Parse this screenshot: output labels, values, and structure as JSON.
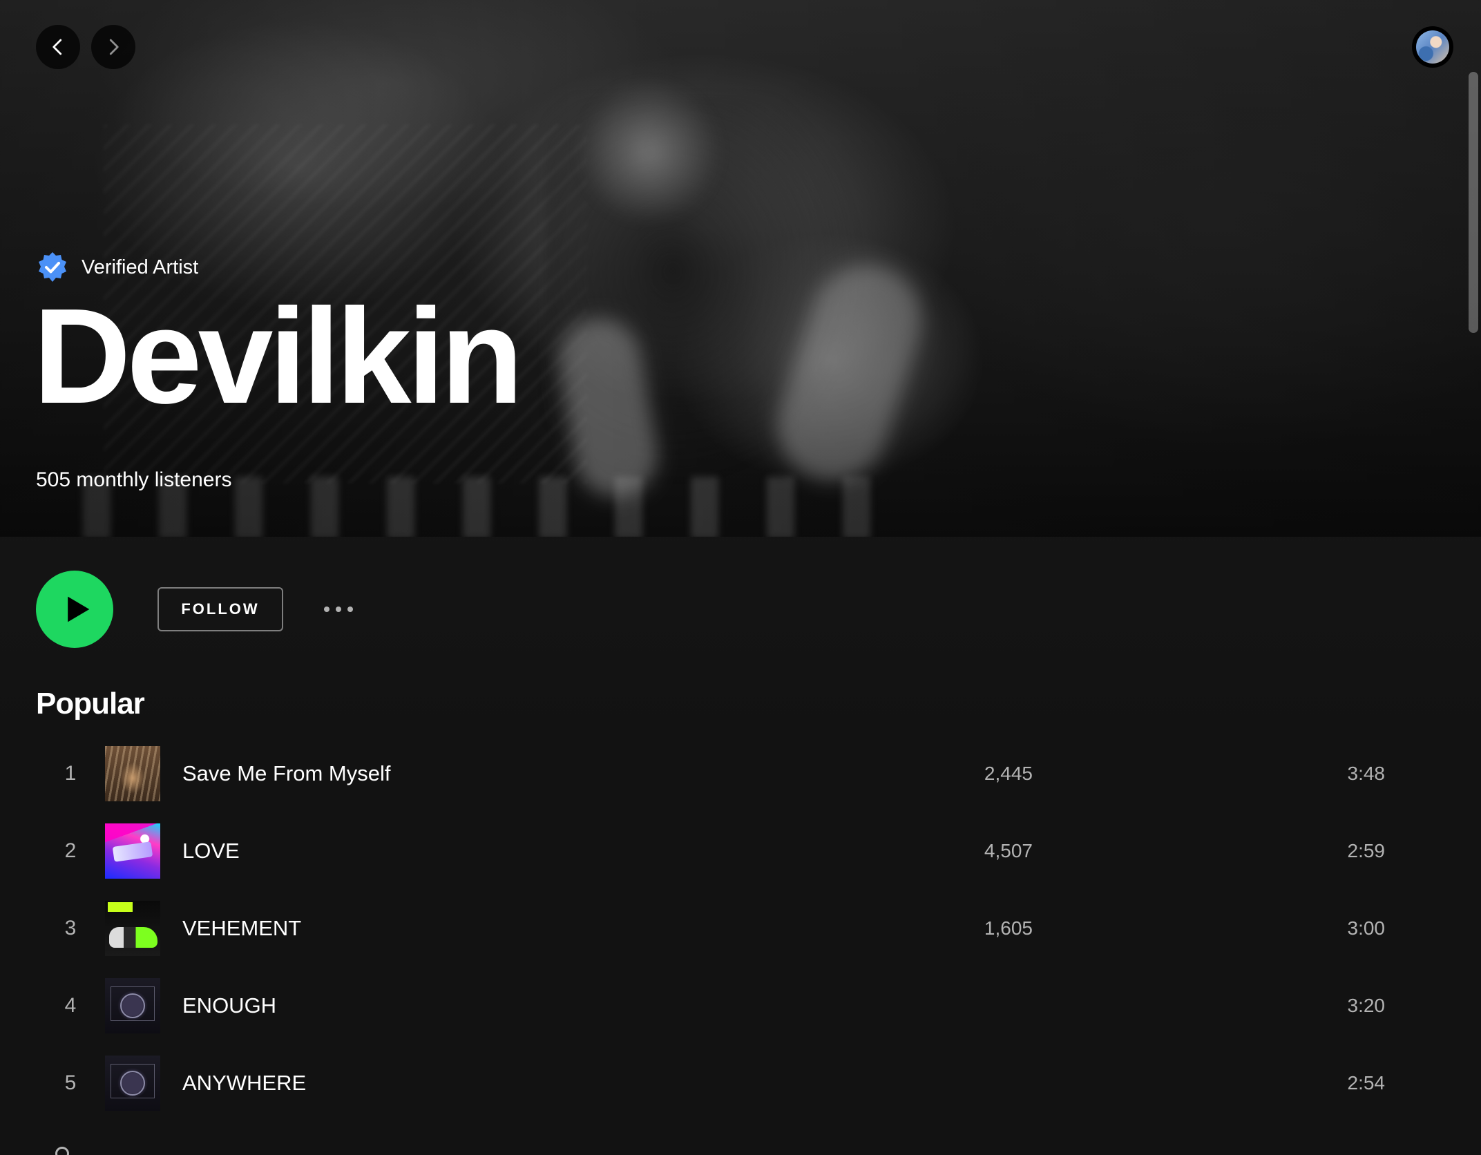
{
  "header": {
    "back_icon": "chevron-left-icon",
    "forward_icon": "chevron-right-icon",
    "avatar_icon": "user-avatar"
  },
  "artist": {
    "verified_label": "Verified Artist",
    "name": "Devilkin",
    "monthly_listeners": "505 monthly listeners"
  },
  "actions": {
    "play_icon": "play-icon",
    "follow_label": "FOLLOW",
    "more_icon": "more-dots-icon",
    "accent_color": "#1ed760"
  },
  "popular": {
    "title": "Popular",
    "tracks": [
      {
        "number": "1",
        "title": "Save Me From Myself",
        "plays": "2,445",
        "duration": "3:48"
      },
      {
        "number": "2",
        "title": "LOVE",
        "plays": "4,507",
        "duration": "2:59"
      },
      {
        "number": "3",
        "title": "VEHEMENT",
        "plays": "1,605",
        "duration": "3:00"
      },
      {
        "number": "4",
        "title": "ENOUGH",
        "plays": "",
        "duration": "3:20"
      },
      {
        "number": "5",
        "title": "ANYWHERE",
        "plays": "",
        "duration": "2:54"
      }
    ]
  }
}
